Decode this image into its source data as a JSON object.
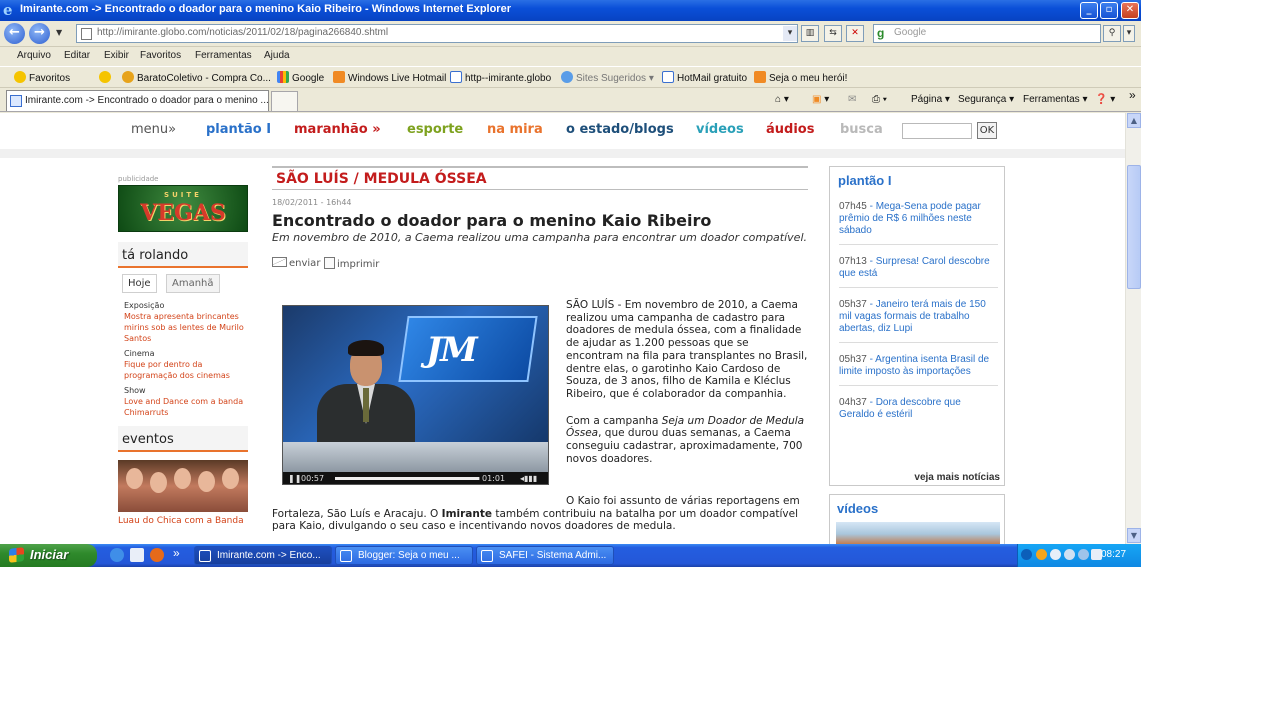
{
  "window": {
    "title": "Imirante.com -> Encontrado o doador para o menino Kaio Ribeiro - Windows Internet Explorer",
    "minimize_icon": "minimize-icon",
    "maximize_icon": "maximize-icon",
    "close_icon": "close-icon"
  },
  "address_bar": {
    "url": "http://imirante.globo.com/noticias/2011/02/18/pagina266840.shtml",
    "search_placeholder": "Google",
    "search_brand": "g"
  },
  "menu_bar": {
    "items": [
      "Arquivo",
      "Editar",
      "Exibir",
      "Favoritos",
      "Ferramentas",
      "Ajuda"
    ]
  },
  "favorites_bar": {
    "favoritos_label": "Favoritos",
    "items": [
      "BaratoColetivo - Compra Co...",
      "Google",
      "Windows Live Hotmail",
      "http--imirante.globo",
      "Sites Sugeridos",
      "HotMail gratuito",
      "Seja o meu herói!"
    ]
  },
  "tab_bar": {
    "active_tab": "Imirante.com -> Encontrado o doador para o menino ...",
    "commands": [
      "Página",
      "Segurança",
      "Ferramentas"
    ],
    "more": "»"
  },
  "site_nav": {
    "items": [
      {
        "label": "menu»",
        "color": "#555555"
      },
      {
        "label": "plantão I",
        "color": "#2a71c9"
      },
      {
        "label": "maranhão »",
        "color": "#c31c1c"
      },
      {
        "label": "esporte",
        "color": "#7ea21f"
      },
      {
        "label": "na mira",
        "color": "#e9732d"
      },
      {
        "label": "o estado/blogs",
        "color": "#1e4f7a"
      },
      {
        "label": "vídeos",
        "color": "#2aa0b8"
      },
      {
        "label": "áudios",
        "color": "#c31c1c"
      },
      {
        "label": "busca",
        "color": "#b9b9b9"
      }
    ],
    "ok_label": "OK"
  },
  "left_column": {
    "ad_label": "publicidade",
    "ad_banner": {
      "top": "SUITE",
      "main": "VEGAS"
    },
    "ta_rolando_title": "tá rolando",
    "day_tabs": [
      "Hoje",
      "Amanhã"
    ],
    "agenda": [
      {
        "category": "Exposição",
        "description": "Mostra apresenta brincantes mirins sob as lentes de Murilo Santos"
      },
      {
        "category": "Cinema",
        "description": "Fique por dentro da programação dos cinemas"
      },
      {
        "category": "Show",
        "description": "Love and Dance com a banda Chimarruts"
      }
    ],
    "eventos_title": "eventos",
    "eventos_caption": "Luau do Chica com a Banda"
  },
  "article": {
    "section": "SÃO LUÍS / MEDULA ÓSSEA",
    "date": "18/02/2011 - 16h44",
    "headline": "Encontrado o doador para o menino Kaio Ribeiro",
    "subtitle": "Em novembro de 2010, a Caema realizou uma campanha para encontrar um doador compatível.",
    "enviar_label": "enviar",
    "imprimir_label": "imprimir",
    "video": {
      "brand": "JM",
      "time_elapsed": "00:57",
      "time_total": "01:01",
      "progress": 0.99
    },
    "para1": "SÃO LUÍS - Em novembro de 2010, a Caema realizou uma campanha de cadastro para doadores de medula óssea, com a finalidade de ajudar as 1.200 pessoas que se encontram na fila para transplantes no Brasil, dentre elas, o garotinho Kaio Cardoso de Souza, de 3 anos, filho de Kamila e Kléclus Ribeiro, que é colaborador da companhia.",
    "para2_pre": "Com a campanha ",
    "para2_em": "Seja um Doador de Medula Óssea",
    "para2_post": ", que durou duas semanas, a Caema conseguiu cadastrar, aproximadamente, 700 novos doadores.",
    "para3_pre": "O Kaio foi assunto de várias reportagens em Fortaleza, São Luís e Aracaju. O ",
    "para3_bold": "Imirante",
    "para3_post": " também contribuiu na batalha por um doador compatível para Kaio, divulgando o seu caso e incentivando novos doadores de medula."
  },
  "right_column": {
    "plantao_title": "plantão I",
    "news": [
      {
        "time": "07h45",
        "text": "Mega-Sena pode pagar prêmio de R$ 6 milhões neste sábado"
      },
      {
        "time": "07h13",
        "text": "Surpresa! Carol descobre que está"
      },
      {
        "time": "05h37",
        "text": "Janeiro terá mais de 150 mil vagas formais de trabalho abertas, diz Lupi"
      },
      {
        "time": "05h37",
        "text": "Argentina isenta Brasil de limite imposto às importações"
      },
      {
        "time": "04h37",
        "text": "Dora descobre que Geraldo é estéril"
      }
    ],
    "ver_mais": "veja mais notícias",
    "videos_title": "vídeos"
  },
  "taskbar": {
    "start_label": "Iniciar",
    "more": "»",
    "buttons": [
      {
        "label": "Imirante.com -> Enco...",
        "active": true
      },
      {
        "label": "Blogger: Seja o meu ...",
        "active": false
      },
      {
        "label": "SAFEI - Sistema Admi...",
        "active": false
      }
    ],
    "clock": "08:27"
  }
}
